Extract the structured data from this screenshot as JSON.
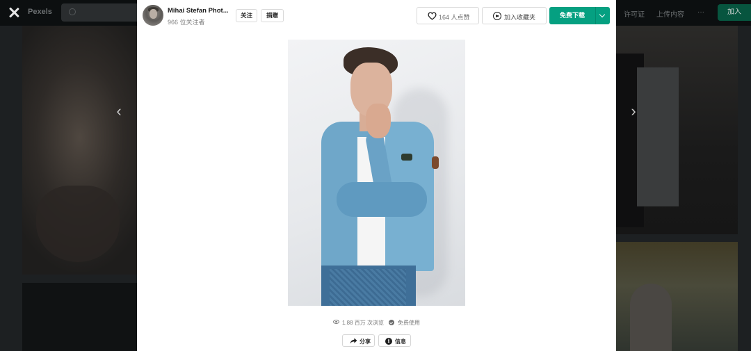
{
  "background": {
    "logo": "Pexels",
    "nav_links": [
      "许可证",
      "上传内容",
      "···"
    ],
    "join_label": "加入"
  },
  "header": {
    "author_name": "Mihai Stefan Phot...",
    "followers": "966 位关注者",
    "follow_label": "关注",
    "donate_label": "捐赠",
    "like_label": "164 人点赞",
    "collect_label": "加入收藏夹",
    "download_label": "免费下载"
  },
  "footer": {
    "views": "1.88 百万 次浏览",
    "license": "免费使用",
    "share_label": "分享",
    "info_label": "信息"
  },
  "colors": {
    "accent": "#05a081",
    "overlay": "#1d2022"
  },
  "icons": {
    "close": "close-icon",
    "heart": "heart-icon",
    "plus": "plus-circle-icon",
    "chevron": "chevron-down-icon",
    "eye": "eye-icon",
    "check": "check-circle-icon",
    "share": "share-arrow-icon",
    "info": "info-icon",
    "prev": "chevron-left-icon",
    "next": "chevron-right-icon"
  }
}
